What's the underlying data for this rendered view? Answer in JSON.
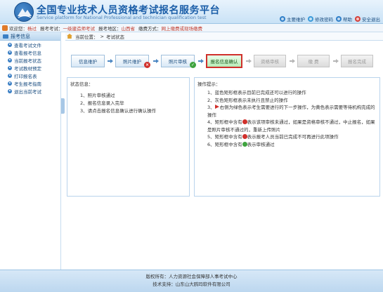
{
  "header": {
    "title": "全国专业技术人员资格考试报名服务平台",
    "subtitle": "Service platform for National Professional and technician qualification test",
    "links": [
      {
        "label": "主要维护",
        "icon": "home-icon",
        "color": "#2f7fc8"
      },
      {
        "label": "修改密码",
        "icon": "key-icon",
        "color": "#3b9ad9"
      },
      {
        "label": "帮助",
        "icon": "help-icon",
        "color": "#2f7fc8"
      },
      {
        "label": "安全退出",
        "icon": "power-icon",
        "color": "#d43f3a"
      }
    ]
  },
  "info_bar": {
    "welcome_label": "欢迎您：",
    "welcome_value": "杨过",
    "exam_label": "报考考试：",
    "exam_value": "一级建造师考试",
    "area_label": "报考地区：",
    "area_value": "山西省",
    "pay_label": "缴费方式：",
    "pay_value": "网上缴费或现场缴费"
  },
  "sidebar": {
    "header": "报考信息",
    "items": [
      {
        "label": "查看考试文件"
      },
      {
        "label": "查看报考信息"
      },
      {
        "label": "当前报考状态"
      },
      {
        "label": "考试教材预定"
      },
      {
        "label": "打印报名表"
      },
      {
        "label": "考生报考指南"
      },
      {
        "label": "退出当前考试"
      }
    ]
  },
  "breadcrumb": {
    "label": "当前位置：",
    "sep": ">",
    "current": "考试状态"
  },
  "flow": {
    "steps": [
      {
        "label": "信息维护",
        "state": "done"
      },
      {
        "label": "照片维护",
        "state": "done",
        "badge": "no"
      },
      {
        "label": "照片审核",
        "state": "done",
        "badge": "ok"
      },
      {
        "label": "报名信息确认",
        "state": "active"
      },
      {
        "label": "资格审核",
        "state": "todo"
      },
      {
        "label": "缴 费",
        "state": "todo"
      },
      {
        "label": "报名完成",
        "state": "todo"
      }
    ]
  },
  "status_panel": {
    "title": "状态信息：",
    "lines": [
      "1、照片审核通过",
      "2、报名信息录入完毕",
      "3、请点击报名信息确认进行确认操作"
    ]
  },
  "tips_panel": {
    "title": "操作提示：",
    "line1": "1、蓝色矩形框表示目前已完成还可以进行的操作",
    "line2": "2、灰色矩形框表示未执行且禁止的操作",
    "line3_pre": "3、",
    "line3_post": "右侧为绿色表示考生需要进行的下一步操作，为黄色表示需要等待机构完成的操作",
    "line4_pre": "4、矩形框中含有",
    "line4_post": "表示该项审核未通过，如果是资格审核不通过，中止报名，如果是照片审核不通过的，重新上传照片",
    "line5_pre": "5、矩形框中含有",
    "line5_post": "表示报考人员当前已完成不可再进行此项操作",
    "line6_pre": "6、矩形框中含有",
    "line6_post": "表示审核通过"
  },
  "footer": {
    "copyright": "版权所有：人力资源社会保障部人事考试中心",
    "support": "技术支持：山东山大鸥玛软件有限公司"
  }
}
